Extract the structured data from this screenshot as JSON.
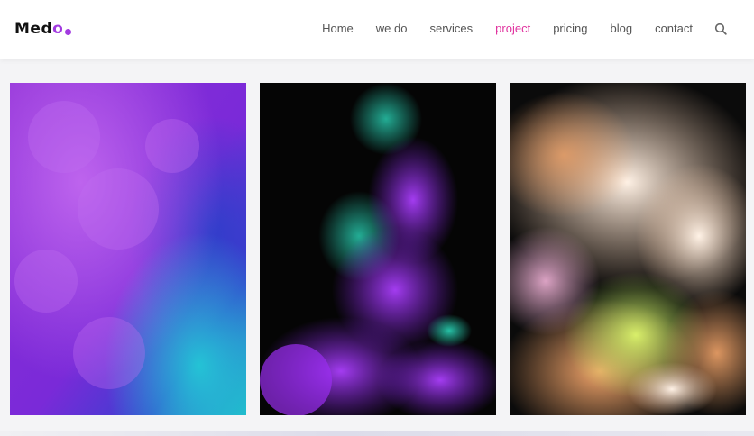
{
  "brand": {
    "logo_main": "Med",
    "logo_accent": "o",
    "accent_color": "#a23be0"
  },
  "nav": {
    "items": [
      {
        "label": "Home"
      },
      {
        "label": "we do"
      },
      {
        "label": "services"
      },
      {
        "label": "project"
      },
      {
        "label": "pricing"
      },
      {
        "label": "blog"
      },
      {
        "label": "contact"
      }
    ],
    "active": "project",
    "active_color": "#e0349f",
    "search_icon": "search-icon"
  },
  "gallery": {
    "images": [
      {
        "subject": "purple-blue ink smoke"
      },
      {
        "subject": "purple and teal ink on black"
      },
      {
        "subject": "pastel multicolor ink cloud"
      }
    ]
  }
}
